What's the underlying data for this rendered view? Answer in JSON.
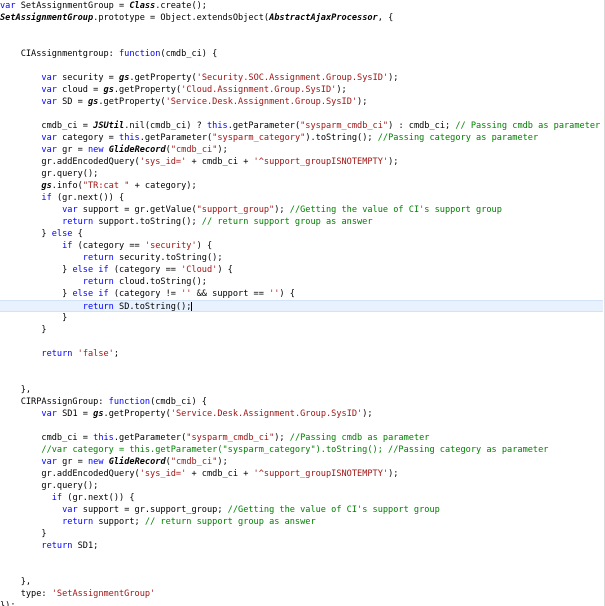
{
  "editor": {
    "lines": [
      [
        [
          "kw",
          "var"
        ],
        [
          "t",
          " SetAssignmentGroup = "
        ],
        [
          "typ",
          "Class"
        ],
        [
          "t",
          ".create();"
        ]
      ],
      [
        [
          "typ",
          "SetAssignmentGroup"
        ],
        [
          "t",
          ".prototype = Object.extendsObject("
        ],
        [
          "typ",
          "AbstractAjaxProcessor"
        ],
        [
          "t",
          ", {"
        ]
      ],
      [],
      [],
      [
        [
          "t",
          "    CIAssignmentgroup: "
        ],
        [
          "kw",
          "function"
        ],
        [
          "t",
          "(cmdb_ci) {"
        ]
      ],
      [],
      [
        [
          "t",
          "        "
        ],
        [
          "kw",
          "var"
        ],
        [
          "t",
          " security = "
        ],
        [
          "typ",
          "gs"
        ],
        [
          "t",
          ".getProperty("
        ],
        [
          "str",
          "'Security.SOC.Assignment.Group.SysID'"
        ],
        [
          "t",
          ");"
        ]
      ],
      [
        [
          "t",
          "        "
        ],
        [
          "kw",
          "var"
        ],
        [
          "t",
          " cloud = "
        ],
        [
          "typ",
          "gs"
        ],
        [
          "t",
          ".getProperty("
        ],
        [
          "str",
          "'Cloud.Assignment.Group.SysID'"
        ],
        [
          "t",
          ");"
        ]
      ],
      [
        [
          "t",
          "        "
        ],
        [
          "kw",
          "var"
        ],
        [
          "t",
          " SD = "
        ],
        [
          "typ",
          "gs"
        ],
        [
          "t",
          ".getProperty("
        ],
        [
          "str",
          "'Service.Desk.Assignment.Group.SysID'"
        ],
        [
          "t",
          ");"
        ]
      ],
      [],
      [
        [
          "t",
          "        cmdb_ci = "
        ],
        [
          "typ",
          "JSUtil"
        ],
        [
          "t",
          ".nil(cmdb_ci) ? "
        ],
        [
          "kw",
          "this"
        ],
        [
          "t",
          ".getParameter("
        ],
        [
          "str",
          "\"sysparm_cmdb_ci\""
        ],
        [
          "t",
          ") : cmdb_ci; "
        ],
        [
          "com",
          "// Passing cmdb as parameter"
        ]
      ],
      [
        [
          "t",
          "        "
        ],
        [
          "kw",
          "var"
        ],
        [
          "t",
          " category = "
        ],
        [
          "kw",
          "this"
        ],
        [
          "t",
          ".getParameter("
        ],
        [
          "str",
          "\"sysparm_category\""
        ],
        [
          "t",
          ").toString(); "
        ],
        [
          "com",
          "//Passing category as parameter"
        ]
      ],
      [
        [
          "t",
          "        "
        ],
        [
          "kw",
          "var"
        ],
        [
          "t",
          " gr = "
        ],
        [
          "kw",
          "new"
        ],
        [
          "t",
          " "
        ],
        [
          "typ",
          "GlideRecord"
        ],
        [
          "t",
          "("
        ],
        [
          "str",
          "\"cmdb_ci\""
        ],
        [
          "t",
          ");"
        ]
      ],
      [
        [
          "t",
          "        gr.addEncodedQuery("
        ],
        [
          "str",
          "'sys_id='"
        ],
        [
          "t",
          " + cmdb_ci + "
        ],
        [
          "str",
          "'^support_groupISNOTEMPTY'"
        ],
        [
          "t",
          ");"
        ]
      ],
      [
        [
          "t",
          "        gr.query();"
        ]
      ],
      [
        [
          "t",
          "        "
        ],
        [
          "typ",
          "gs"
        ],
        [
          "t",
          ".info("
        ],
        [
          "str",
          "\"TR:cat \""
        ],
        [
          "t",
          " + category);"
        ]
      ],
      [
        [
          "t",
          "        "
        ],
        [
          "kw",
          "if"
        ],
        [
          "t",
          " (gr.next()) {"
        ]
      ],
      [
        [
          "t",
          "            "
        ],
        [
          "kw",
          "var"
        ],
        [
          "t",
          " support = gr.getValue("
        ],
        [
          "str",
          "\"support_group\""
        ],
        [
          "t",
          "); "
        ],
        [
          "com",
          "//Getting the value of CI's support group"
        ]
      ],
      [
        [
          "t",
          "            "
        ],
        [
          "kw",
          "return"
        ],
        [
          "t",
          " support.toString(); "
        ],
        [
          "com",
          "// return support group as answer"
        ]
      ],
      [
        [
          "t",
          "        } "
        ],
        [
          "kw",
          "else"
        ],
        [
          "t",
          " {"
        ]
      ],
      [
        [
          "t",
          "            "
        ],
        [
          "kw",
          "if"
        ],
        [
          "t",
          " (category == "
        ],
        [
          "str",
          "'security'"
        ],
        [
          "t",
          ") {"
        ]
      ],
      [
        [
          "t",
          "                "
        ],
        [
          "kw",
          "return"
        ],
        [
          "t",
          " security.toString();"
        ]
      ],
      [
        [
          "t",
          "            } "
        ],
        [
          "kw",
          "else if"
        ],
        [
          "t",
          " (category == "
        ],
        [
          "str",
          "'Cloud'"
        ],
        [
          "t",
          ") {"
        ]
      ],
      [
        [
          "t",
          "                "
        ],
        [
          "kw",
          "return"
        ],
        [
          "t",
          " cloud.toString();"
        ]
      ],
      [
        [
          "t",
          "            } "
        ],
        [
          "kw",
          "else if"
        ],
        [
          "t",
          " (category != "
        ],
        [
          "str",
          "''"
        ],
        [
          "t",
          " && support == "
        ],
        [
          "str",
          "''"
        ],
        [
          "t",
          ") {"
        ]
      ],
      [
        [
          "t",
          "                "
        ],
        [
          "kw",
          "return"
        ],
        [
          "t",
          " SD.toString();"
        ]
      ],
      [
        [
          "t",
          "            }"
        ]
      ],
      [
        [
          "t",
          "        }"
        ]
      ],
      [],
      [
        [
          "t",
          "        "
        ],
        [
          "kw",
          "return"
        ],
        [
          "t",
          " "
        ],
        [
          "str",
          "'false'"
        ],
        [
          "t",
          ";"
        ]
      ],
      [],
      [],
      [
        [
          "t",
          "    },"
        ]
      ],
      [
        [
          "t",
          "    CIRPAssignGroup: "
        ],
        [
          "kw",
          "function"
        ],
        [
          "t",
          "(cmdb_ci) {"
        ]
      ],
      [
        [
          "t",
          "        "
        ],
        [
          "kw",
          "var"
        ],
        [
          "t",
          " SD1 = "
        ],
        [
          "typ",
          "gs"
        ],
        [
          "t",
          ".getProperty("
        ],
        [
          "str",
          "'Service.Desk.Assignment.Group.SysID'"
        ],
        [
          "t",
          ");"
        ]
      ],
      [],
      [
        [
          "t",
          "        cmdb_ci = "
        ],
        [
          "kw",
          "this"
        ],
        [
          "t",
          ".getParameter("
        ],
        [
          "str",
          "\"sysparm_cmdb_ci\""
        ],
        [
          "t",
          "); "
        ],
        [
          "com",
          "//Passing cmdb as parameter"
        ]
      ],
      [
        [
          "t",
          "        "
        ],
        [
          "com",
          "//var category = this.getParameter(\"sysparm_category\").toString(); //Passing category as parameter"
        ]
      ],
      [
        [
          "t",
          "        "
        ],
        [
          "kw",
          "var"
        ],
        [
          "t",
          " gr = "
        ],
        [
          "kw",
          "new"
        ],
        [
          "t",
          " "
        ],
        [
          "typ",
          "GlideRecord"
        ],
        [
          "t",
          "("
        ],
        [
          "str",
          "\"cmdb_ci\""
        ],
        [
          "t",
          ");"
        ]
      ],
      [
        [
          "t",
          "        gr.addEncodedQuery("
        ],
        [
          "str",
          "'sys_id='"
        ],
        [
          "t",
          " + cmdb_ci + "
        ],
        [
          "str",
          "'^support_groupISNOTEMPTY'"
        ],
        [
          "t",
          ");"
        ]
      ],
      [
        [
          "t",
          "        gr.query();"
        ]
      ],
      [
        [
          "t",
          "          "
        ],
        [
          "kw",
          "if"
        ],
        [
          "t",
          " (gr.next()) {"
        ]
      ],
      [
        [
          "t",
          "            "
        ],
        [
          "kw",
          "var"
        ],
        [
          "t",
          " support = gr.support_group; "
        ],
        [
          "com",
          "//Getting the value of CI's support group"
        ]
      ],
      [
        [
          "t",
          "            "
        ],
        [
          "kw",
          "return"
        ],
        [
          "t",
          " support; "
        ],
        [
          "com",
          "// return support group as answer"
        ]
      ],
      [
        [
          "t",
          "        }"
        ]
      ],
      [
        [
          "t",
          "        "
        ],
        [
          "kw",
          "return"
        ],
        [
          "t",
          " SD1;"
        ]
      ],
      [],
      [],
      [
        [
          "t",
          "    },"
        ]
      ],
      [
        [
          "t",
          "    type: "
        ],
        [
          "str",
          "'SetAssignmentGroup'"
        ]
      ],
      [
        [
          "t",
          "});"
        ]
      ]
    ]
  }
}
